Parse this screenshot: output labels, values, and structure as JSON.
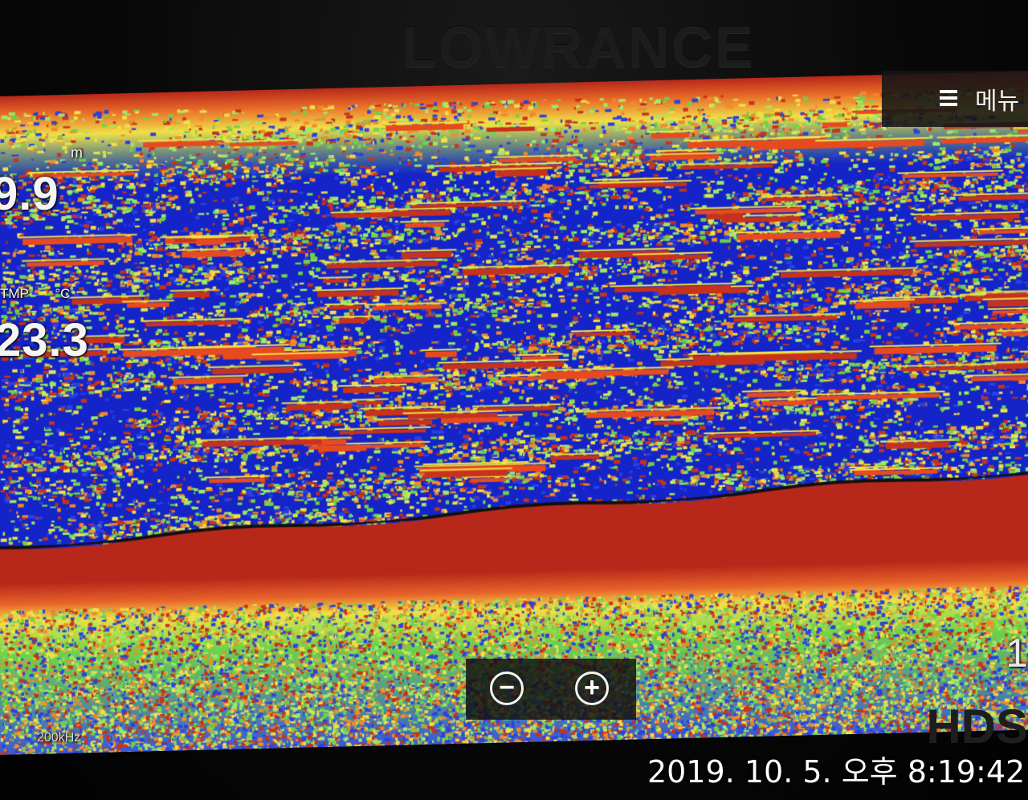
{
  "device": {
    "brand": "LOWRANCE",
    "model_badge": "HDS"
  },
  "menu": {
    "label": "메뉴",
    "icon": "hamburger-menu-icon"
  },
  "readouts": {
    "depth_unit": "m",
    "depth_value": "9.9",
    "temp_label": "TMP",
    "temp_unit": "°C",
    "temp_value": "23.3",
    "range_value": "1",
    "frequency": "200kHz"
  },
  "zoom": {
    "zoom_out_label": "−",
    "zoom_in_label": "+",
    "zoom_out_icon": "zoom-out-icon",
    "zoom_in_icon": "zoom-in-icon"
  },
  "photo": {
    "timestamp": "2019. 10. 5. 오후 8:19:42"
  },
  "colors": {
    "water_blue": "#1424c8",
    "echo_green": "#6fd24a",
    "echo_yellow": "#f0e048",
    "echo_red": "#c8321c",
    "bottom_red": "#b8281a"
  }
}
